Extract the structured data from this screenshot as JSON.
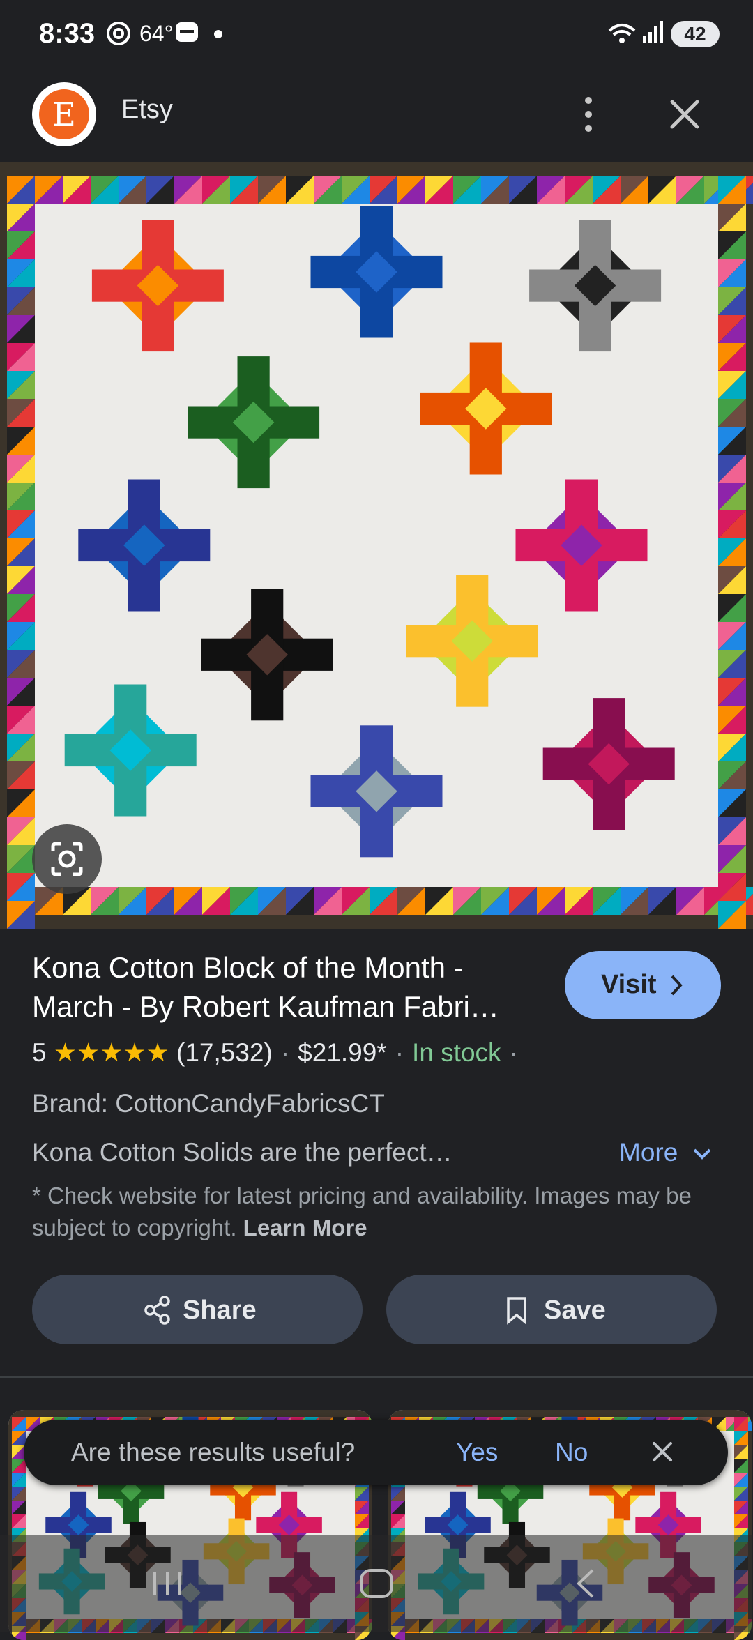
{
  "status_bar": {
    "time": "8:33",
    "temperature": "64°",
    "battery": "42",
    "icons": [
      "threads-icon",
      "news-icon",
      "wifi-icon",
      "signal-icon"
    ]
  },
  "header": {
    "site_name": "Etsy",
    "logo_letter": "E"
  },
  "product": {
    "title": "Kona Cotton Block of the Month - March - By Robert Kaufman Fabri…",
    "visit_label": "Visit",
    "rating": "5",
    "stars": "★★★★★",
    "review_count": "(17,532)",
    "price": "$21.99*",
    "availability": "In stock",
    "brand": "Brand: CottonCandyFabricsCT",
    "description": "Kona Cotton Solids are the perfect…",
    "more_label": "More",
    "disclaimer": "* Check website for latest pricing and availability. Images may be subject to copyright.",
    "learn_more": "Learn More"
  },
  "actions": {
    "share_label": "Share",
    "save_label": "Save"
  },
  "feedback": {
    "question": "Are these results useful?",
    "yes": "Yes",
    "no": "No"
  },
  "colors": {
    "accent": "#8ab4f8",
    "in_stock": "#81c995",
    "star": "#fbbc04",
    "button_bg": "#3c4453",
    "etsy": "#f1641e"
  }
}
